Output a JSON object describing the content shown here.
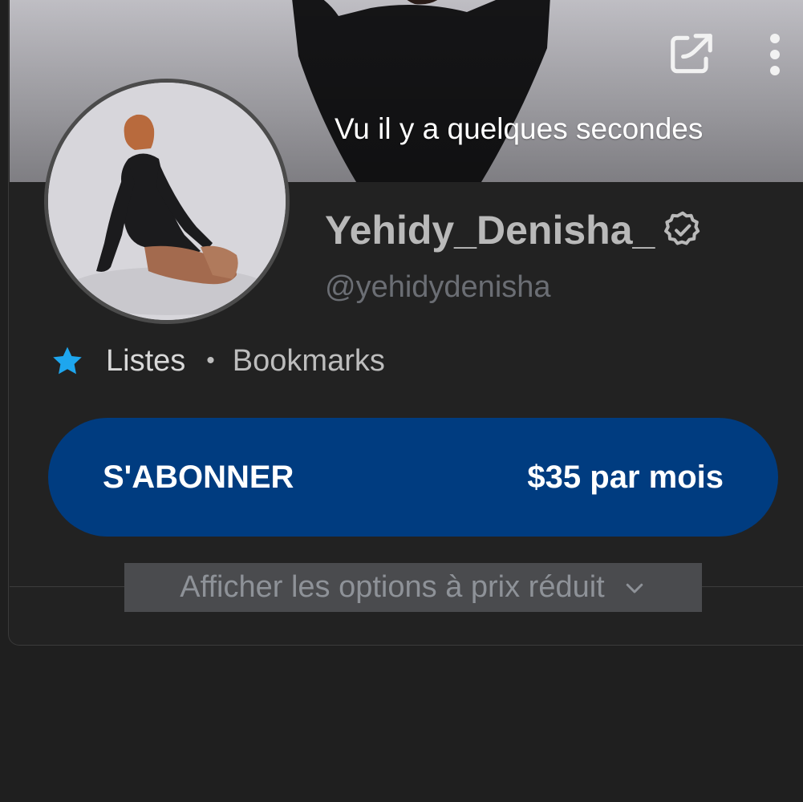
{
  "banner": {
    "last_seen": "Vu il y a quelques secondes",
    "icons": {
      "share": "share-icon",
      "more": "more-vertical-icon"
    }
  },
  "profile": {
    "display_name": "Yehidy_Denisha_",
    "username": "@yehidydenisha",
    "verified_icon": "verified-badge-icon"
  },
  "lists": {
    "icon": "star-icon",
    "listes": "Listes",
    "separator": "•",
    "bookmarks": "Bookmarks"
  },
  "subscribe": {
    "label": "S'ABONNER",
    "price": "$35 par mois"
  },
  "discount": {
    "label": "Afficher les options à prix réduit",
    "icon": "chevron-down-icon"
  },
  "colors": {
    "background": "#1f1f1f",
    "card": "#222222",
    "subscribe_button": "#003c80",
    "star": "#1ea6ee",
    "display_name": "#b9b9b9",
    "username": "#6b6e74"
  }
}
